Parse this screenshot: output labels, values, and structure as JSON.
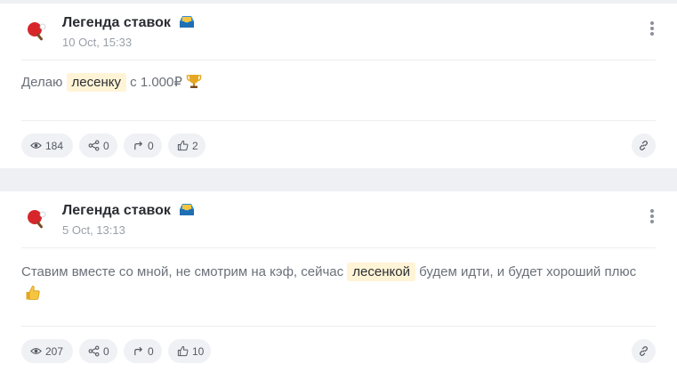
{
  "posts": [
    {
      "author": "Легенда ставок",
      "time": "10 Oct, 15:33",
      "text_before": "Делаю",
      "highlight": "лесенку",
      "text_after": "с 1.000₽",
      "end_emoji": "trophy",
      "stats": {
        "views": "184",
        "shares": "0",
        "reposts": "0",
        "likes": "2"
      }
    },
    {
      "author": "Легенда ставок",
      "time": "5 Oct, 13:13",
      "text_before": "Ставим вместе со мной, не смотрим на кэф, сейчас",
      "highlight": "лесенкой",
      "text_after": "будем идти, и будет хороший плюс",
      "end_emoji": "thumbs-up",
      "stats": {
        "views": "207",
        "shares": "0",
        "reposts": "0",
        "likes": "10"
      }
    }
  ],
  "icons": {
    "avatar": "ping-pong-icon",
    "author_badge": "inbox-tray-icon",
    "views": "eye-icon",
    "shares": "share-icon",
    "reposts": "repost-arrow-icon",
    "likes": "thumbs-up-icon",
    "link": "link-icon",
    "more": "more-vertical-icon"
  },
  "colors": {
    "page_bg": "#eef0f3",
    "card_bg": "#ffffff",
    "highlight_bg": "#fff4d6",
    "pill_bg": "#eff1f4",
    "muted_text": "#9aa0a8"
  }
}
